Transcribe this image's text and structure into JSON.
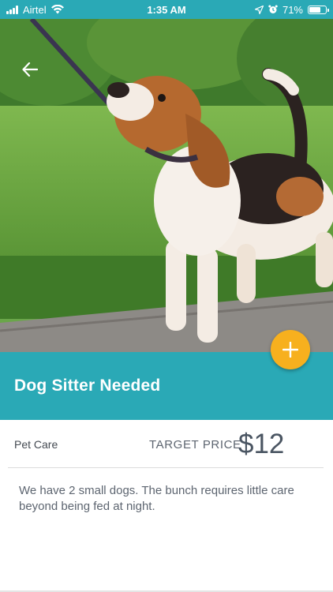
{
  "status_bar": {
    "carrier": "Airtel",
    "time": "1:35 AM",
    "battery_percent": "71%",
    "battery_level": 0.71
  },
  "listing": {
    "title": "Dog Sitter Needed",
    "category": "Pet Care",
    "target_price_label": "TARGET PRICE",
    "price": "$12",
    "description": "We have 2 small dogs. The bunch requires little care beyond being fed at night."
  },
  "icons": {
    "back": "back-arrow-icon",
    "add": "plus-icon",
    "wifi": "wifi-icon",
    "location": "location-arrow-icon",
    "alarm": "alarm-icon",
    "battery": "battery-icon"
  },
  "colors": {
    "primary": "#2aa9b6",
    "accent": "#f7b01e"
  }
}
